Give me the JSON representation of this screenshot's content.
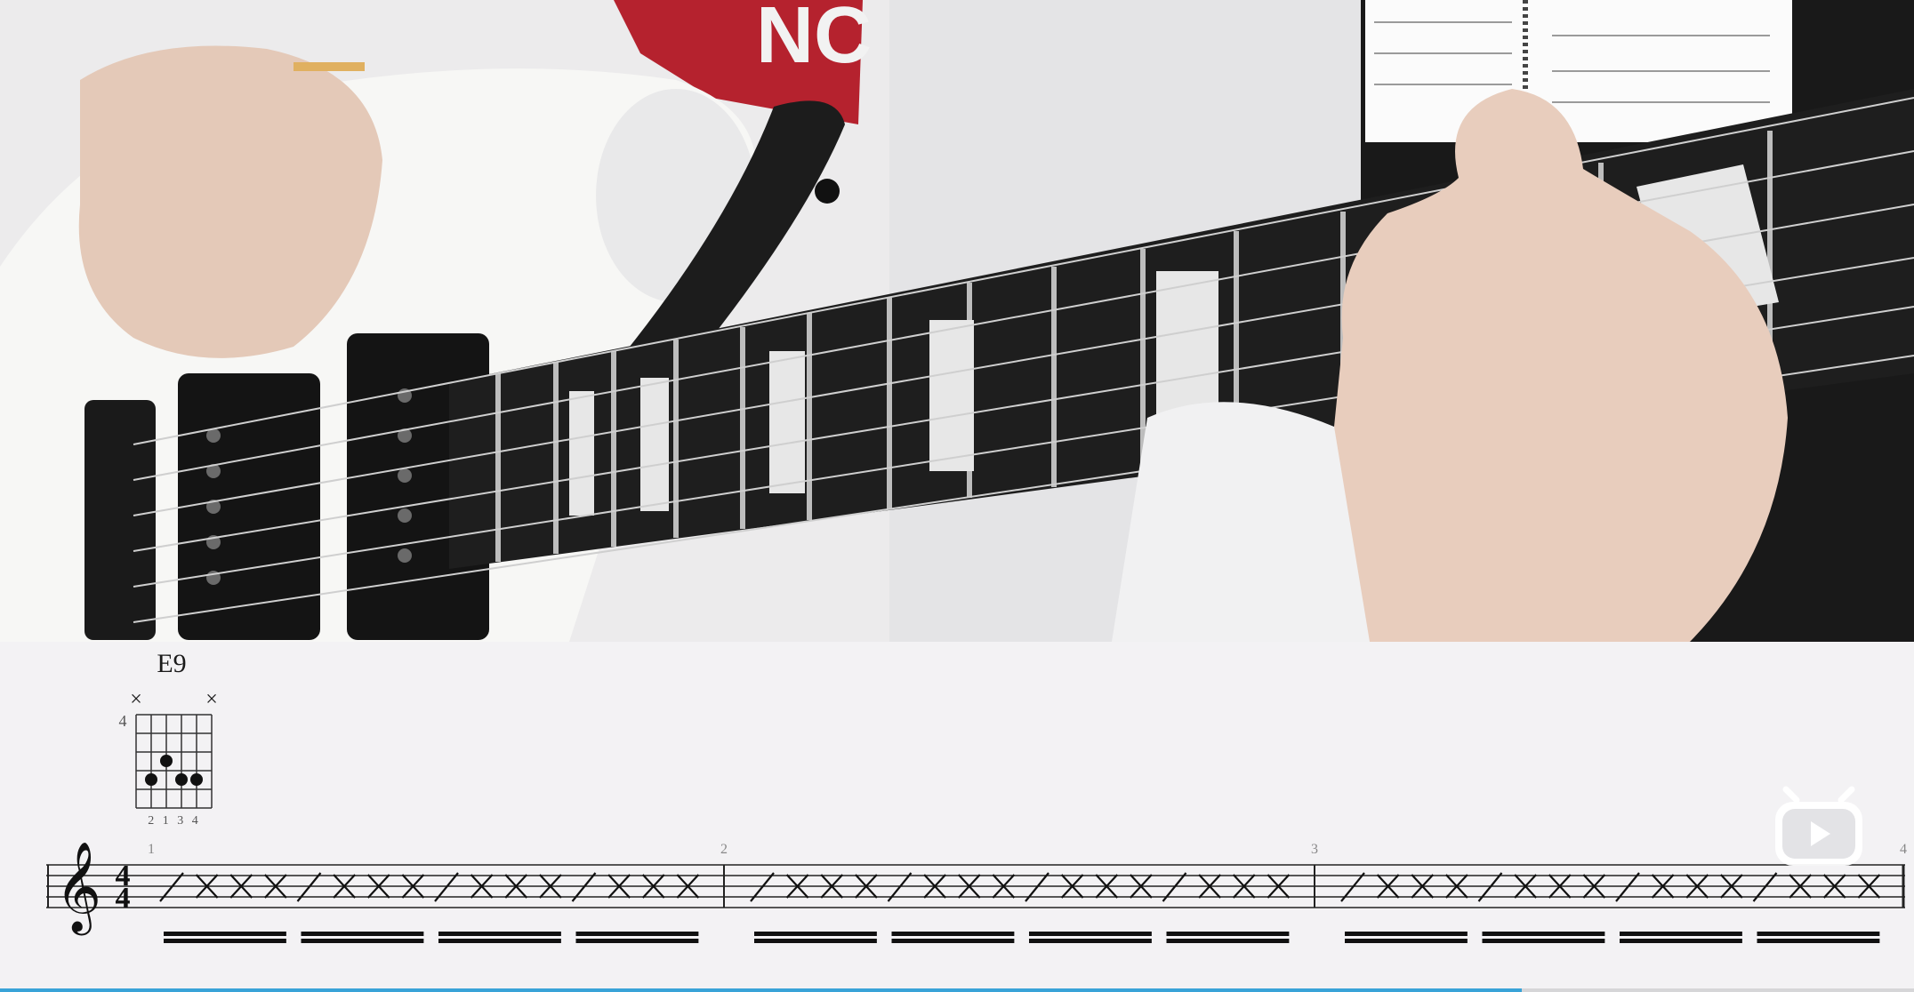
{
  "video": {
    "progress_fraction": 0.795
  },
  "chord_diagram": {
    "chord_name": "E9",
    "base_fret": "4",
    "string_markers": [
      "×",
      "",
      "",
      "",
      "",
      "×"
    ],
    "fingering": "2 1 3 4"
  },
  "notation": {
    "clef": "treble",
    "time_signature": {
      "top": "4",
      "bottom": "4"
    },
    "measure_numbers": [
      "1",
      "2",
      "3",
      "4"
    ],
    "rhythm_pattern": "slash-cross"
  },
  "colors": {
    "accent": "#39a3d8",
    "logo": "#ffffff",
    "ink": "#1a1a1a"
  },
  "icons": {
    "watermark": "bilibili-tv-icon"
  }
}
